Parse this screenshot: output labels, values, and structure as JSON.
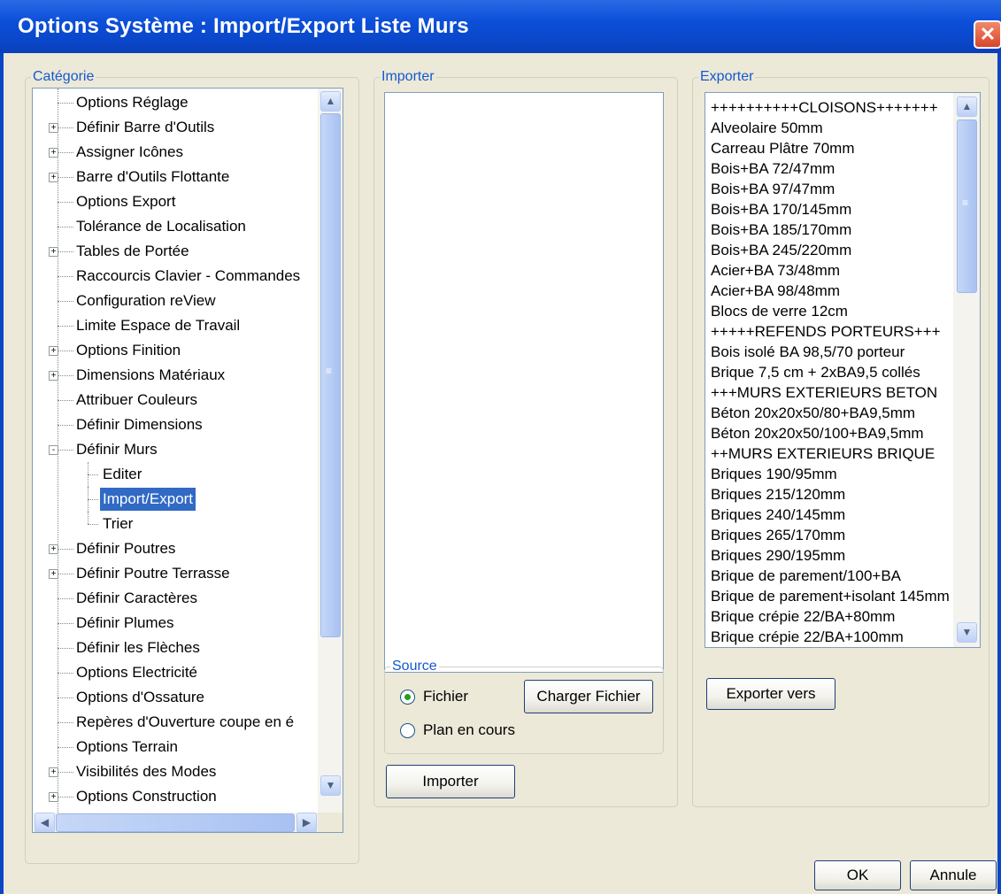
{
  "window": {
    "title": "Options Système : Import/Export Liste Murs",
    "close_glyph": "✕"
  },
  "categorie": {
    "legend": "Catégorie",
    "items": [
      {
        "label": "Options Réglage",
        "expand": ""
      },
      {
        "label": "Définir Barre d'Outils",
        "expand": "+"
      },
      {
        "label": "Assigner Icônes",
        "expand": "+"
      },
      {
        "label": "Barre d'Outils Flottante",
        "expand": "+"
      },
      {
        "label": "Options Export",
        "expand": ""
      },
      {
        "label": "Tolérance de Localisation",
        "expand": ""
      },
      {
        "label": "Tables de Portée",
        "expand": "+"
      },
      {
        "label": "Raccourcis Clavier - Commandes",
        "expand": ""
      },
      {
        "label": "Configuration reView",
        "expand": ""
      },
      {
        "label": "Limite Espace de Travail",
        "expand": ""
      },
      {
        "label": "Options Finition",
        "expand": "+"
      },
      {
        "label": "Dimensions Matériaux",
        "expand": "+"
      },
      {
        "label": "Attribuer Couleurs",
        "expand": ""
      },
      {
        "label": "Définir Dimensions",
        "expand": ""
      },
      {
        "label": "Définir Murs",
        "expand": "-"
      },
      {
        "label": "Editer",
        "child": true
      },
      {
        "label": "Import/Export",
        "child": true,
        "selected": true
      },
      {
        "label": "Trier",
        "child": true
      },
      {
        "label": "Définir Poutres",
        "expand": "+"
      },
      {
        "label": "Définir Poutre Terrasse",
        "expand": "+"
      },
      {
        "label": "Définir Caractères",
        "expand": ""
      },
      {
        "label": "Définir Plumes",
        "expand": ""
      },
      {
        "label": "Définir les Flèches",
        "expand": ""
      },
      {
        "label": "Options Electricité",
        "expand": ""
      },
      {
        "label": "Options d'Ossature",
        "expand": ""
      },
      {
        "label": "Repères d'Ouverture coupe en é",
        "expand": ""
      },
      {
        "label": "Options Terrain",
        "expand": ""
      },
      {
        "label": "Visibilités des Modes",
        "expand": "+"
      },
      {
        "label": "Options Construction",
        "expand": "+"
      }
    ]
  },
  "importer": {
    "legend": "Importer",
    "source_legend": "Source",
    "radio_fichier": "Fichier",
    "radio_plan": "Plan en cours",
    "charger_button": "Charger Fichier",
    "importer_button": "Importer"
  },
  "exporter": {
    "legend": "Exporter",
    "items": [
      "++++++++++CLOISONS+++++++",
      "Alveolaire 50mm",
      "Carreau Plâtre 70mm",
      "Bois+BA 72/47mm",
      "Bois+BA 97/47mm",
      "Bois+BA 170/145mm",
      "Bois+BA 185/170mm",
      "Bois+BA 245/220mm",
      "Acier+BA 73/48mm",
      "Acier+BA 98/48mm",
      "Blocs de verre 12cm",
      "+++++REFENDS PORTEURS+++",
      "Bois isolé BA 98,5/70 porteur",
      "Brique 7,5 cm + 2xBA9,5 collés",
      "+++MURS EXTERIEURS BETON",
      "Béton 20x20x50/80+BA9,5mm",
      "Béton 20x20x50/100+BA9,5mm",
      "++MURS EXTERIEURS BRIQUE",
      "Briques 190/95mm",
      "Briques 215/120mm",
      "Briques 240/145mm",
      "Briques 265/170mm",
      "Briques 290/195mm",
      "Brique de parement/100+BA",
      "Brique de parement+isolant 145mm",
      "Brique crépie 22/BA+80mm",
      "Brique crépie 22/BA+100mm"
    ],
    "exporter_button": "Exporter vers"
  },
  "footer": {
    "ok_label": "OK",
    "cancel_label": "Annule"
  },
  "icons": {
    "scroll_up": "▲",
    "scroll_down": "▼",
    "scroll_left": "◀",
    "scroll_right": "▶",
    "grip": "≡"
  },
  "colors": {
    "title_bar": "#0a46c8",
    "selection": "#316ac5",
    "group_legend": "#1558d0"
  }
}
